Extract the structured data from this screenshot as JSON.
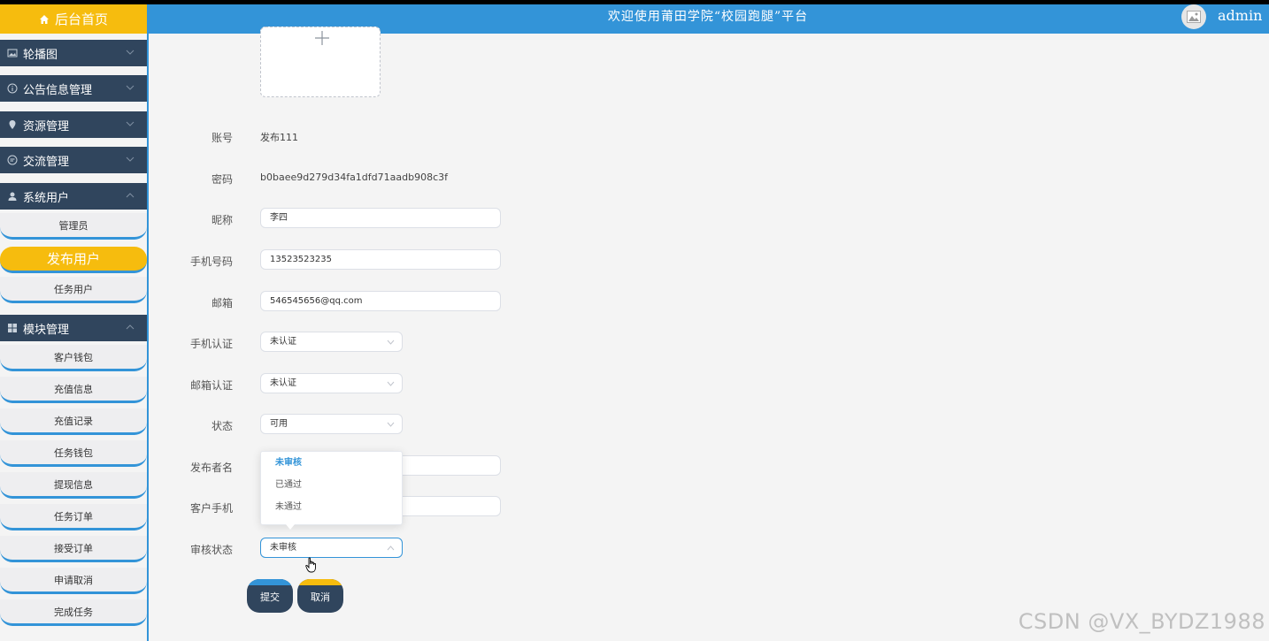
{
  "header": {
    "brand": "后台首页",
    "title": "欢迎使用莆田学院“校园跑腿”平台",
    "user": "admin"
  },
  "sidebar": {
    "groups": [
      {
        "label": "轮播图",
        "icon": "image-icon"
      },
      {
        "label": "公告信息管理",
        "icon": "info-icon"
      },
      {
        "label": "资源管理",
        "icon": "location-icon"
      },
      {
        "label": "交流管理",
        "icon": "chat-icon"
      },
      {
        "label": "系统用户",
        "icon": "user-icon"
      },
      {
        "label": "模块管理",
        "icon": "grid-icon"
      }
    ],
    "system_users": [
      "管理员",
      "发布用户",
      "任务用户"
    ],
    "modules": [
      "客户钱包",
      "充值信息",
      "充值记录",
      "任务钱包",
      "提现信息",
      "任务订单",
      "接受订单",
      "申请取消",
      "完成任务"
    ]
  },
  "form": {
    "account_label": "账号",
    "account_value": "发布111",
    "password_label": "密码",
    "password_value": "b0baee9d279d34fa1dfd71aadb908c3f",
    "nickname_label": "昵称",
    "nickname_value": "李四",
    "phone_label": "手机号码",
    "phone_value": "13523523235",
    "email_label": "邮箱",
    "email_value": "546545656@qq.com",
    "phone_verify_label": "手机认证",
    "phone_verify_value": "未认证",
    "email_verify_label": "邮箱认证",
    "email_verify_value": "未认证",
    "status_label": "状态",
    "status_value": "可用",
    "publisher_label": "发布者名",
    "customer_phone_label": "客户手机",
    "audit_label": "审核状态",
    "audit_value": "未审核",
    "audit_options": [
      "未审核",
      "已通过",
      "未通过"
    ],
    "submit": "提交",
    "cancel": "取消"
  },
  "colors": {
    "blue": "#3394d8",
    "yellow": "#f6bc0e",
    "navy": "#30455d"
  },
  "watermark": "CSDN @VX_BYDZ1988"
}
